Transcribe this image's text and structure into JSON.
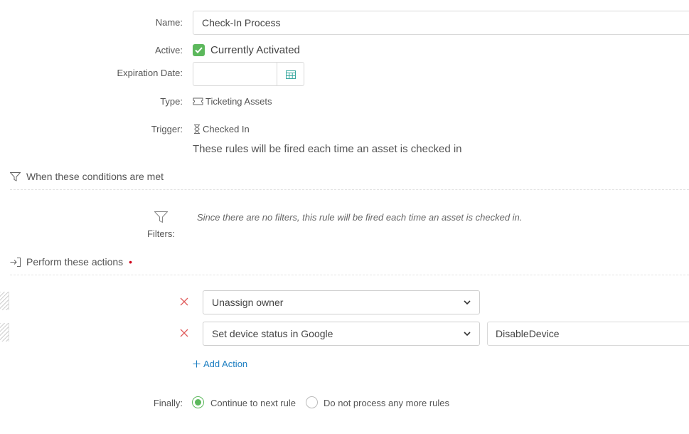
{
  "form": {
    "name_label": "Name:",
    "name_value": "Check-In Process",
    "active_label": "Active:",
    "active_text": "Currently Activated",
    "expiration_label": "Expiration Date:",
    "type_label": "Type:",
    "type_value": "Ticketing Assets",
    "trigger_label": "Trigger:",
    "trigger_value": "Checked In",
    "trigger_description": "These rules will be fired each time an asset is checked in"
  },
  "conditions": {
    "title": "When these conditions are met",
    "filters_label": "Filters:",
    "empty_message": "Since there are no filters, this rule will be fired each time an asset is checked in."
  },
  "actions": {
    "title": "Perform these actions",
    "required_mark": "•",
    "items": [
      {
        "action": "Unassign owner"
      },
      {
        "action": "Set device status in Google",
        "parameter": "DisableDevice"
      }
    ],
    "add_label": "Add Action"
  },
  "finally": {
    "label": "Finally:",
    "options": [
      {
        "label": "Continue to next rule",
        "selected": true
      },
      {
        "label": "Do not process any more rules",
        "selected": false
      }
    ]
  },
  "colors": {
    "accent_green": "#5cb85c",
    "link_blue": "#1e7fc2",
    "remove_red": "#e05a5a"
  },
  "icons": [
    "check-icon",
    "calendar-icon",
    "ticket-icon",
    "hourglass-icon",
    "filter-icon",
    "sign-in-icon",
    "close-icon",
    "chevron-down-icon",
    "plus-icon"
  ]
}
